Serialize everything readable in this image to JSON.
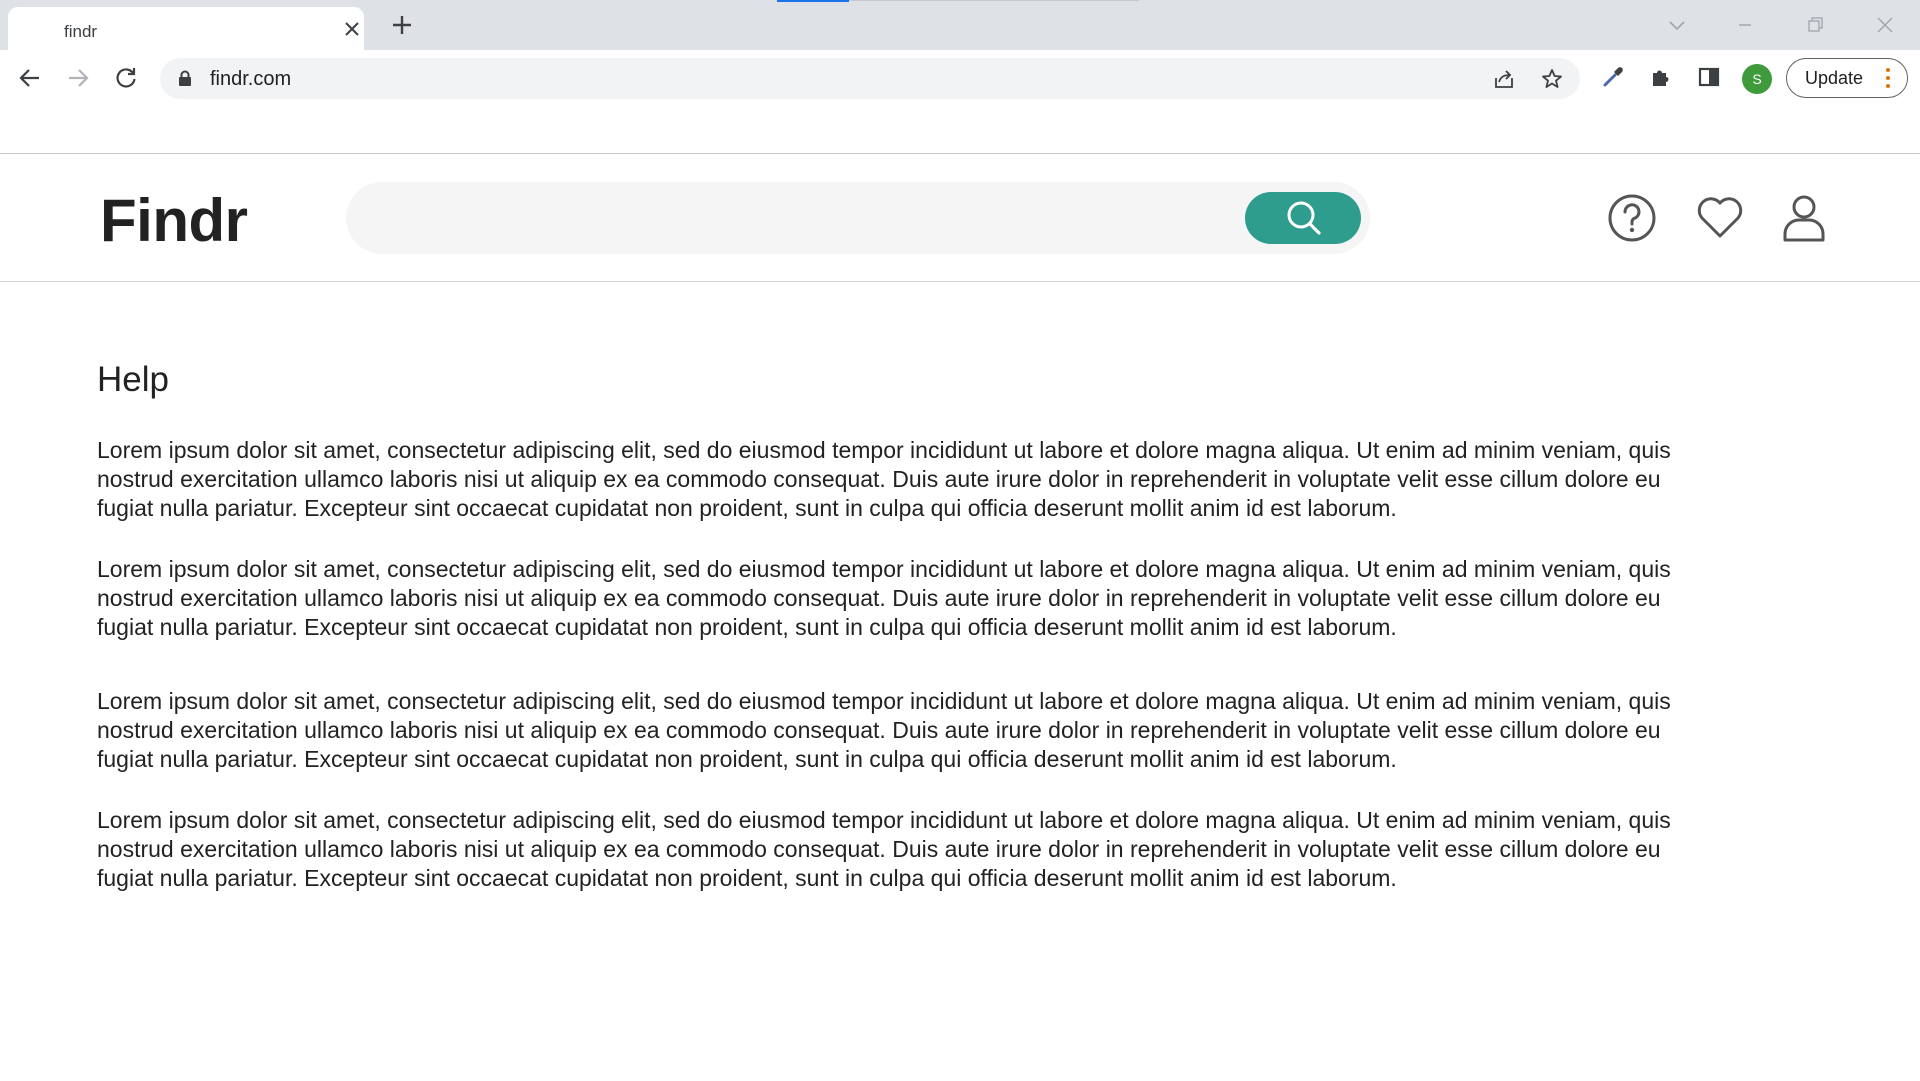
{
  "browser": {
    "tab": {
      "title": "findr"
    },
    "url": "findr.com",
    "update_label": "Update",
    "profile_initial": "S",
    "accent": "#1a73e8",
    "profile_color": "#3f9a3c"
  },
  "site": {
    "logo": "Findr",
    "search": {
      "placeholder": "",
      "value": ""
    },
    "accent": "#2e9d8e",
    "header_icons": [
      "help-circle-icon",
      "heart-icon",
      "user-icon"
    ]
  },
  "page": {
    "title": "Help",
    "paragraphs": [
      "Lorem ipsum dolor sit amet, consectetur adipiscing elit, sed do eiusmod tempor incididunt ut labore et dolore magna aliqua. Ut enim ad minim veniam, quis nostrud exercitation ullamco laboris nisi ut aliquip ex ea commodo consequat. Duis aute irure dolor in reprehenderit in voluptate velit esse cillum dolore eu fugiat nulla pariatur. Excepteur sint occaecat cupidatat non proident, sunt in culpa qui officia deserunt mollit anim id est laborum.",
      "Lorem ipsum dolor sit amet, consectetur adipiscing elit, sed do eiusmod tempor incididunt ut labore et dolore magna aliqua. Ut enim ad minim veniam, quis nostrud exercitation ullamco laboris nisi ut aliquip ex ea commodo consequat. Duis aute irure dolor in reprehenderit in voluptate velit esse cillum dolore eu fugiat nulla pariatur. Excepteur sint occaecat cupidatat non proident, sunt in culpa qui officia deserunt mollit anim id est laborum.",
      "Lorem ipsum dolor sit amet, consectetur adipiscing elit, sed do eiusmod tempor incididunt ut labore et dolore magna aliqua. Ut enim ad minim veniam, quis nostrud exercitation ullamco laboris nisi ut aliquip ex ea commodo consequat. Duis aute irure dolor in reprehenderit in voluptate velit esse cillum dolore eu fugiat nulla pariatur. Excepteur sint occaecat cupidatat non proident, sunt in culpa qui officia deserunt mollit anim id est laborum.",
      "Lorem ipsum dolor sit amet, consectetur adipiscing elit, sed do eiusmod tempor incididunt ut labore et dolore magna aliqua. Ut enim ad minim veniam, quis nostrud exercitation ullamco laboris nisi ut aliquip ex ea commodo consequat. Duis aute irure dolor in reprehenderit in voluptate velit esse cillum dolore eu fugiat nulla pariatur. Excepteur sint occaecat cupidatat non proident, sunt in culpa qui officia deserunt mollit anim id est laborum."
    ]
  }
}
